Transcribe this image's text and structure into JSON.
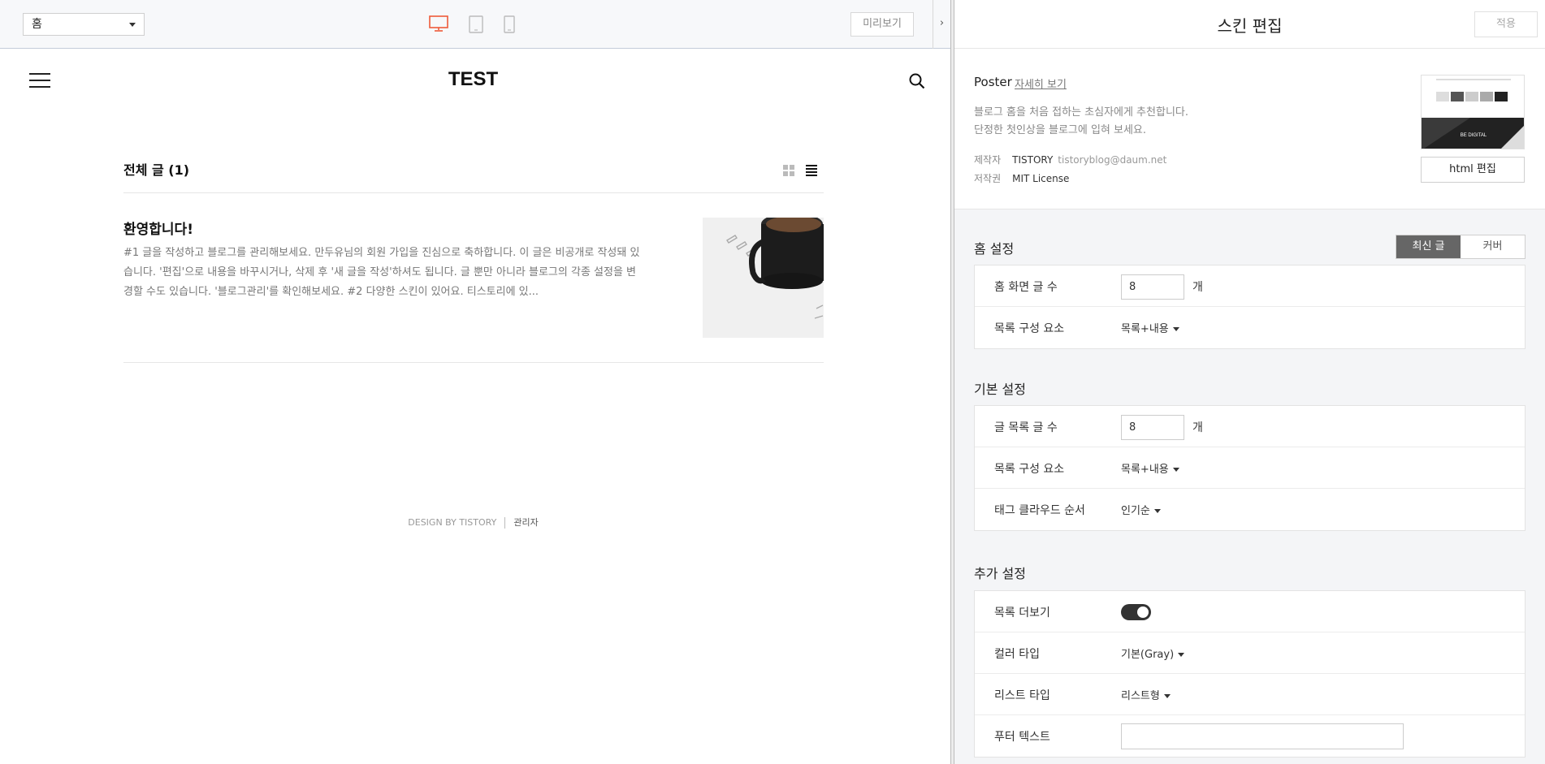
{
  "topbar": {
    "page_select": "홈",
    "preview_label": "미리보기",
    "collapse_arrow": "›",
    "accent_color": "#ef5b3a"
  },
  "blog": {
    "title": "TEST",
    "list_title": "전체 글 (1)",
    "post": {
      "title": "환영합니다!",
      "excerpt": "#1 글을 작성하고 블로그를 관리해보세요. 만두유님의 회원 가입을 진심으로 축하합니다. 이 글은 비공개로 작성돼 있습니다. '편집'으로 내용을 바꾸시거나, 삭제 후 '새 글을 작성'하셔도 됩니다. 글 뿐만 아니라 블로그의 각종 설정을 변경할 수도 있습니다. '블로그관리'를 확인해보세요. #2 다양한 스킨이 있어요. 티스토리에 있..."
    },
    "footer": {
      "design_by": "DESIGN BY TISTORY",
      "admin": "관리자"
    }
  },
  "panel": {
    "title": "스킨 편집",
    "apply_label": "적용",
    "skin": {
      "name": "Poster",
      "detail_link": "자세히 보기",
      "desc_line1": "블로그 홈을 처음 접하는 초심자에게 추천합니다.",
      "desc_line2": "단정한 첫인상을 블로그에 입혀 보세요.",
      "author_label": "제작자",
      "author_value": "TISTORY",
      "author_email": "tistoryblog@daum.net",
      "license_label": "저작권",
      "license_value": "MIT License",
      "thumb_text": "BE DIGITAL",
      "html_edit_label": "html 편집"
    },
    "home": {
      "title": "홈 설정",
      "tab_latest": "최신 글",
      "tab_cover": "커버",
      "rows": {
        "post_count_label": "홈 화면 글 수",
        "post_count_value": "8",
        "post_count_unit": "개",
        "list_elements_label": "목록 구성 요소",
        "list_elements_value": "목록+내용"
      }
    },
    "basic": {
      "title": "기본 설정",
      "rows": {
        "list_count_label": "글 목록 글 수",
        "list_count_value": "8",
        "list_count_unit": "개",
        "list_elements_label": "목록 구성 요소",
        "list_elements_value": "목록+내용",
        "tag_cloud_label": "태그 클라우드 순서",
        "tag_cloud_value": "인기순"
      }
    },
    "extra": {
      "title": "추가 설정",
      "rows": {
        "more_label": "목록 더보기",
        "more_on": true,
        "color_label": "컬러 타입",
        "color_value": "기본(Gray)",
        "list_type_label": "리스트 타입",
        "list_type_value": "리스트형",
        "footer_text_label": "푸터 텍스트",
        "footer_text_value": ""
      }
    }
  }
}
